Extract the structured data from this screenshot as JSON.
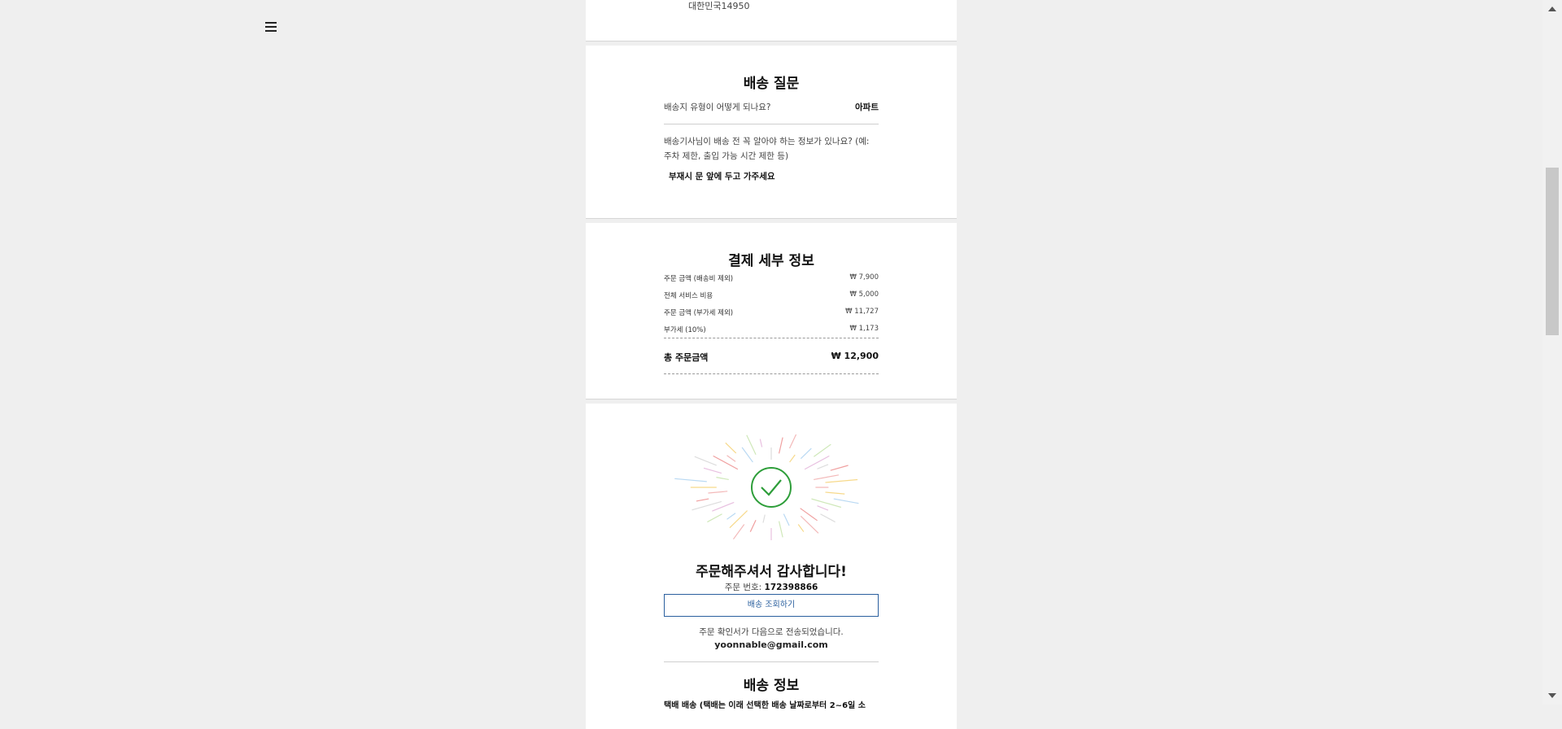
{
  "menu": {
    "icon": "hamburger-menu-icon"
  },
  "address": {
    "line": "대한민국14950"
  },
  "delivery_questions": {
    "title": "배송 질문",
    "q1": {
      "question": "배송지 유형이 어떻게 되나요?",
      "answer": "아파트"
    },
    "q2": {
      "question": "배송기사님이 배송 전 꼭 알아야 하는 정보가 있나요? (예: 주차 제한, 출입 가능 시간 제한 등)",
      "answer": "부재시 문 앞에 두고 가주세요"
    }
  },
  "payment": {
    "title": "결제 세부 정보",
    "rows": [
      {
        "label": "주문 금액 (배송비 제외)",
        "amount": "₩ 7,900"
      },
      {
        "label": "전체 서비스 비용",
        "amount": "₩ 5,000"
      },
      {
        "label": "주문 금액 (부가세 제외)",
        "amount": "₩ 11,727"
      },
      {
        "label": "부가세 (10%)",
        "amount": "₩ 1,173"
      }
    ],
    "total_label": "총 주문금액",
    "total_amount": "₩ 12,900"
  },
  "confirmation": {
    "icon": "checkmark-circle-icon",
    "thanks": "주문해주셔서 감사합니다!",
    "order_label": "주문 번호: ",
    "order_number": "172398866",
    "track_button": "배송 조회하기",
    "sent_text": "주문 확인서가 다음으로 전송되었습니다.",
    "email": "yoonnable@gmail.com",
    "shipping_title": "배송 정보",
    "shipping_cut": "택배 배송 (택배는 이래 선택한 배송 날짜로부터 2~6일 소"
  },
  "colors": {
    "accent": "#2a5f9e",
    "success": "#2e9e3a"
  }
}
